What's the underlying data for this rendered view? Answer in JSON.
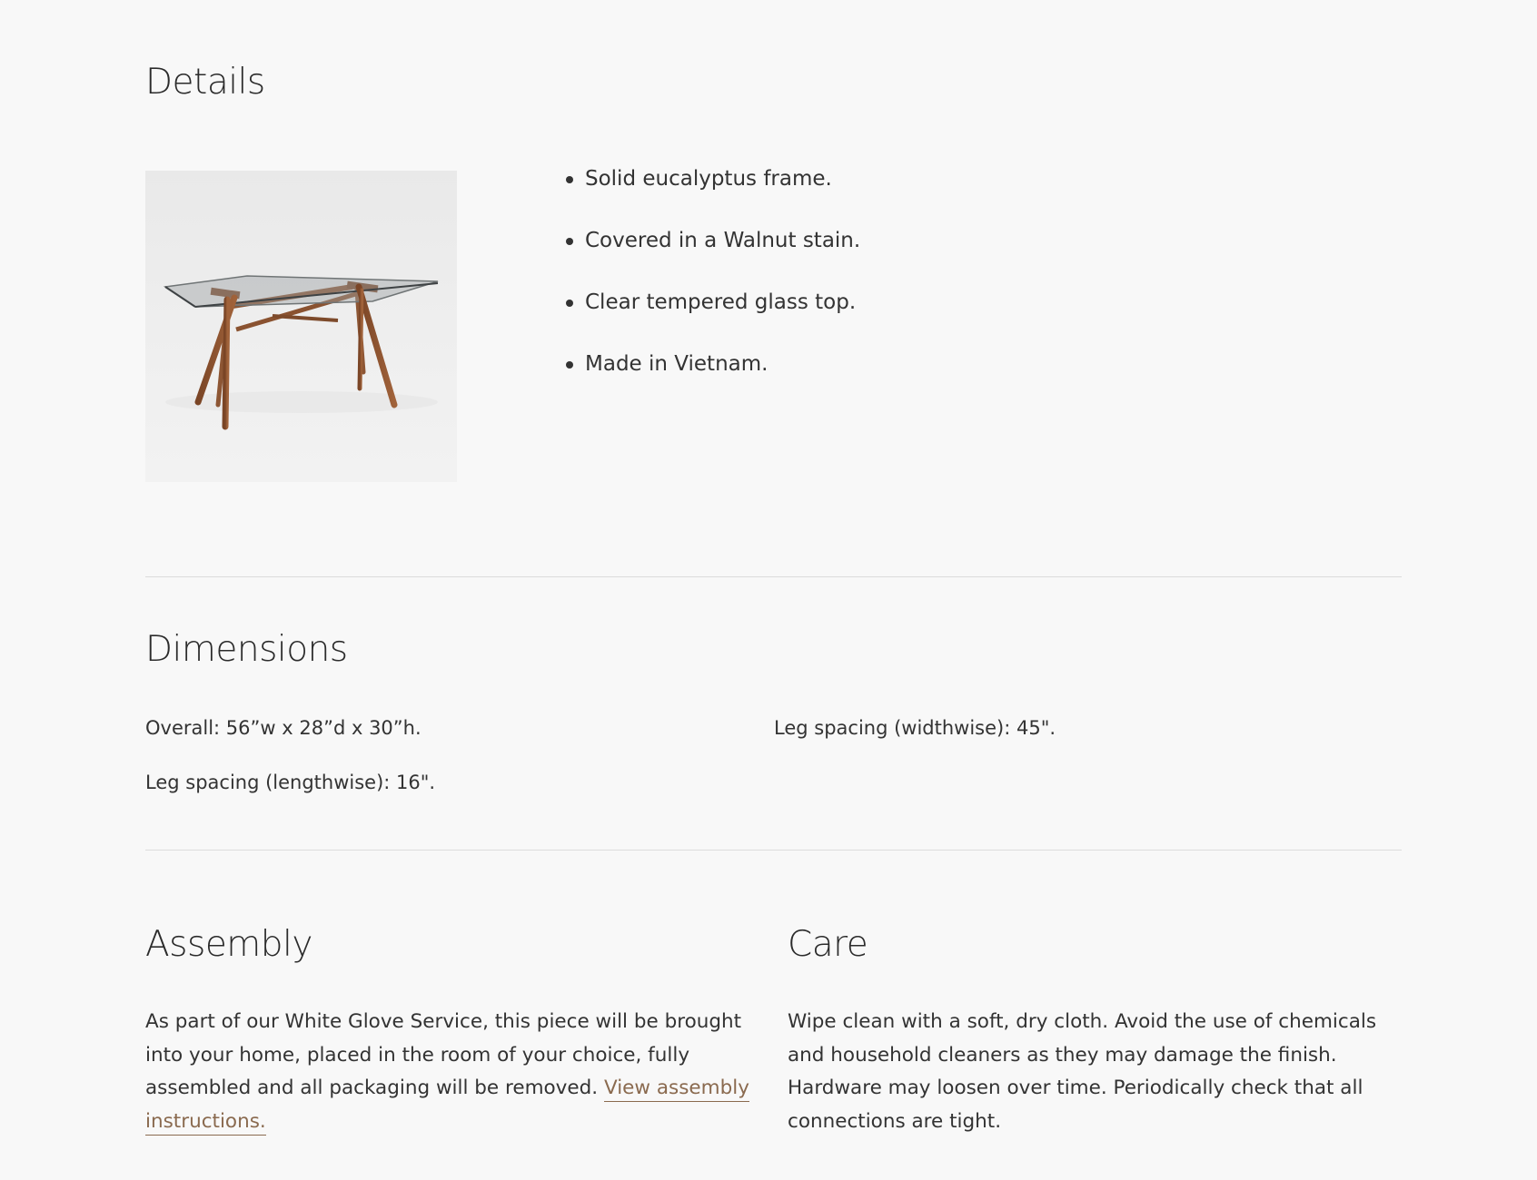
{
  "details": {
    "title": "Details",
    "image_alt": "Glass top walnut desk",
    "bullets": [
      "Solid eucalyptus frame.",
      "Covered in a Walnut stain.",
      "Clear tempered glass top.",
      "Made in Vietnam."
    ]
  },
  "dimensions": {
    "title": "Dimensions",
    "overall": "Overall: 56”w x 28”d x 30”h.",
    "leg_lengthwise": "Leg spacing (lengthwise): 16\".",
    "leg_widthwise": "Leg spacing (widthwise): 45\"."
  },
  "assembly": {
    "title": "Assembly",
    "text": "As part of our White Glove Service, this piece will be brought into your home, placed in the room of your choice, fully assembled and all packaging will be removed.",
    "link_label": "View assembly instructions."
  },
  "care": {
    "title": "Care",
    "text": "Wipe clean with a soft, dry cloth. Avoid the use of chemicals and household cleaners as they may damage the finish. Hardware may loosen over time. Periodically check that all connections are tight."
  },
  "colors": {
    "background": "#f8f8f8",
    "text": "#333333",
    "link": "#8a6a4f",
    "divider": "#dcdcdc"
  }
}
